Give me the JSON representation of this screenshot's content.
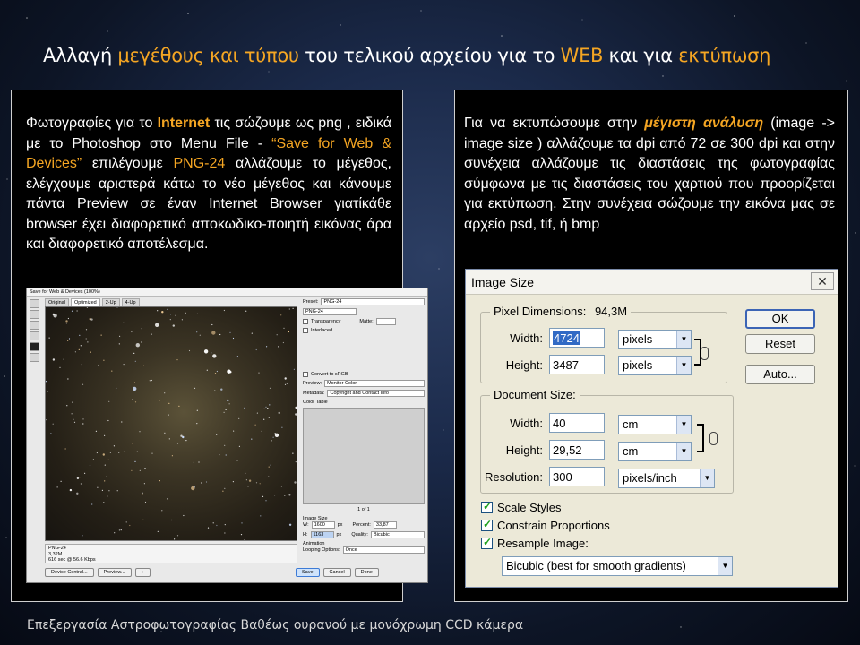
{
  "slide": {
    "title_parts": [
      {
        "text": "Αλλαγή ",
        "accent": false
      },
      {
        "text": "μεγέθους  και τύπου",
        "accent": true
      },
      {
        "text": " του τελικού αρχείου για το ",
        "accent": false
      },
      {
        "text": "WEB",
        "accent": true
      },
      {
        "text": " και για ",
        "accent": false
      },
      {
        "text": "εκτύπωση",
        "accent": true
      }
    ],
    "footer": "Επεξεργασία Αστροφωτογραφίας Βαθέως ουρανού με μονόχρωμη CCD κάμερα",
    "accent_color": "#f5a623"
  },
  "left_panel": {
    "text_parts": [
      {
        "text": "Φωτογραφίες για το ",
        "style": ""
      },
      {
        "text": "Internet",
        "style": "orb"
      },
      {
        "text": " τις σώζουμε ως png , ειδικά με το Photoshop στο Menu File - ",
        "style": ""
      },
      {
        "text": "“Save for Web & Devices”",
        "style": "or"
      },
      {
        "text": " επιλέγουμε ",
        "style": ""
      },
      {
        "text": "PNG-24",
        "style": "or"
      },
      {
        "text": " αλλάζουμε το μέγεθος, ελέγχουμε αριστερά κάτω το νέο μέγεθος και κάνουμε πάντα Preview σε έναν Internet Browser γιατίκάθε browser έχει διαφορετικό αποκωδικο-ποιητή εικόνας άρα και διαφορετικό αποτέλεσμα.",
        "style": ""
      }
    ]
  },
  "right_panel": {
    "text_parts": [
      {
        "text": "Για να εκτυπώσουμε στην ",
        "style": ""
      },
      {
        "text": "μέγιστη ανάλυση",
        "style": "orbi"
      },
      {
        "text": " (image -> image size ) αλλάζουμε τα dpi από 72 σε 300 dpi και στην συνέχεια αλλάζουμε τις διαστάσεις της φωτογραφίας σύμφωνα με τις διαστάσεις του χαρτιού που προορίζεται για εκτύπωση. Στην συνέχεια σώζουμε την εικόνα μας σε αρχείο psd, tif, ή bmp",
        "style": ""
      }
    ]
  },
  "save_for_web": {
    "window_title": "Save for Web & Devices (100%)",
    "tabs": [
      "Original",
      "Optimized",
      "2-Up",
      "4-Up"
    ],
    "preset_label": "Preset:",
    "preset_value": "PNG-24",
    "format_value": "PNG-24",
    "transparency_label": "Transparency",
    "matte_label": "Matte:",
    "interlaced_label": "Interlaced",
    "convert_srgb_label": "Convert to sRGB",
    "preview_label": "Preview:",
    "preview_value": "Monitor Color",
    "metadata_label": "Metadata:",
    "metadata_value": "Copyright and Contact Info",
    "color_table_label": "Color Table",
    "image_size_label": "Image Size",
    "w_label": "W:",
    "w_value": "1600",
    "h_label": "H:",
    "h_value": "1163",
    "px_unit": "px",
    "percent_label": "Percent:",
    "percent_value": "33,87",
    "quality_label": "Quality:",
    "quality_value": "Bicubic",
    "animation_label": "Animation",
    "looping_label": "Looping Options:",
    "looping_value": "Once",
    "frame_counter": "1 of 1",
    "info_format": "PNG-24",
    "info_size": "3,32M",
    "info_time": "616 sec @ 56.6 Kbps",
    "zoom_value": "100%",
    "buttons": {
      "device_central": "Device Central...",
      "preview": "Preview...",
      "save": "Save",
      "cancel": "Cancel",
      "done": "Done"
    }
  },
  "image_size_dialog": {
    "title": "Image Size",
    "pixel_dimensions_label": "Pixel Dimensions:",
    "pixel_dimensions_value": "94,3M",
    "px_width_label": "Width:",
    "px_width_value": "4724",
    "px_width_unit": "pixels",
    "px_height_label": "Height:",
    "px_height_value": "3487",
    "px_height_unit": "pixels",
    "document_size_label": "Document Size:",
    "doc_width_label": "Width:",
    "doc_width_value": "40",
    "doc_width_unit": "cm",
    "doc_height_label": "Height:",
    "doc_height_value": "29,52",
    "doc_height_unit": "cm",
    "resolution_label": "Resolution:",
    "resolution_value": "300",
    "resolution_unit": "pixels/inch",
    "scale_styles_label": "Scale Styles",
    "constrain_label": "Constrain Proportions",
    "resample_label": "Resample Image:",
    "resample_value": "Bicubic (best for smooth gradients)",
    "ok_label": "OK",
    "reset_label": "Reset",
    "auto_label": "Auto..."
  }
}
